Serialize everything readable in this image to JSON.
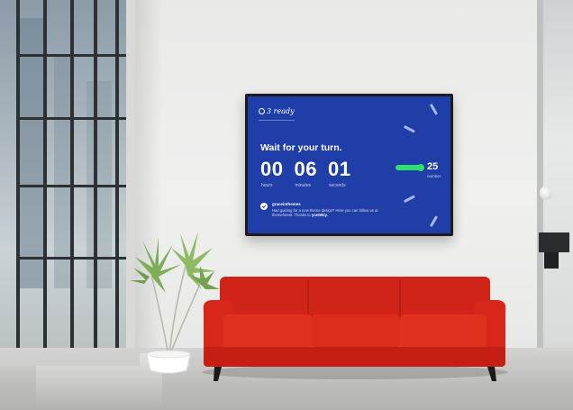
{
  "screen": {
    "logo_text": "3 ready",
    "headline": "Wait for your turn.",
    "countdown": [
      {
        "value": "00",
        "label": "hours"
      },
      {
        "value": "06",
        "label": "minutes"
      },
      {
        "value": "01",
        "label": "seconds"
      }
    ],
    "queue": {
      "number": "25",
      "label": "number"
    },
    "message": {
      "author": "graceinthemes",
      "body": "Had guiding for a new theme design? Here you can follow us at themeforest. Thanks to",
      "link": "yontekiy."
    }
  },
  "colors": {
    "screen_bg": "#1f3ea8",
    "accent_green": "#2ee06c",
    "couch_red": "#d8271a",
    "wall": "#eeeeed"
  },
  "icons": [
    "check-circle-icon",
    "logo-mark-icon"
  ]
}
